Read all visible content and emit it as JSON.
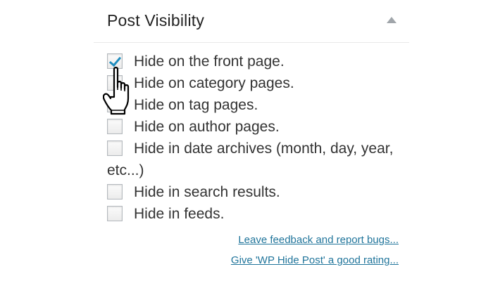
{
  "panel": {
    "title": "Post Visibility",
    "toggle_icon": "triangle-up-icon"
  },
  "options": [
    {
      "label": "Hide on the front page.",
      "checked": true
    },
    {
      "label": "Hide on category pages.",
      "checked": false
    },
    {
      "label": "Hide on tag pages.",
      "checked": false
    },
    {
      "label": "Hide on author pages.",
      "checked": false
    },
    {
      "label": "Hide in date archives (month, day, year, etc...)",
      "checked": false
    },
    {
      "label": "Hide in search results.",
      "checked": false
    },
    {
      "label": "Hide in feeds.",
      "checked": false
    }
  ],
  "links": {
    "feedback": "Leave feedback and report bugs...",
    "rating": "Give 'WP Hide Post' a good rating..."
  },
  "colors": {
    "link": "#21759b",
    "check": "#1e8cbe",
    "text": "#333333"
  },
  "cursor": "hand-pointer-icon"
}
